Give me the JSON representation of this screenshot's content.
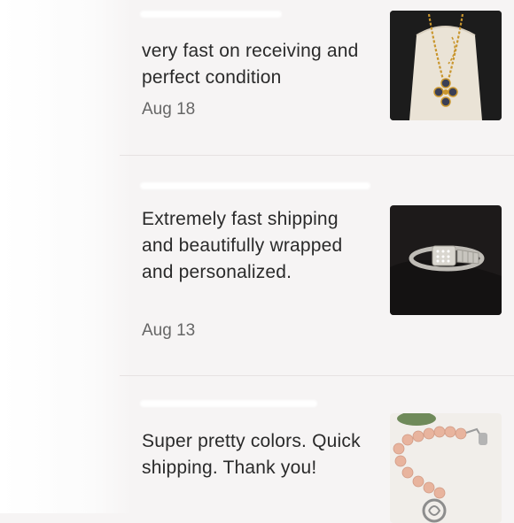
{
  "reviews": [
    {
      "text": "very fast on receiving and perfect condition",
      "date": "Aug 18",
      "thumbnail_icon": "necklace-photo"
    },
    {
      "text": "Extremely fast shipping and beautifully wrapped and personalized.",
      "date": "Aug 13",
      "thumbnail_icon": "ring-photo"
    },
    {
      "text": "Super pretty colors. Quick shipping. Thank you!",
      "date": "",
      "thumbnail_icon": "bracelet-photo"
    }
  ],
  "colors": {
    "background": "#f6f4f4",
    "text": "#2a2a2a",
    "date": "#666666",
    "divider": "#e6e2e2"
  }
}
